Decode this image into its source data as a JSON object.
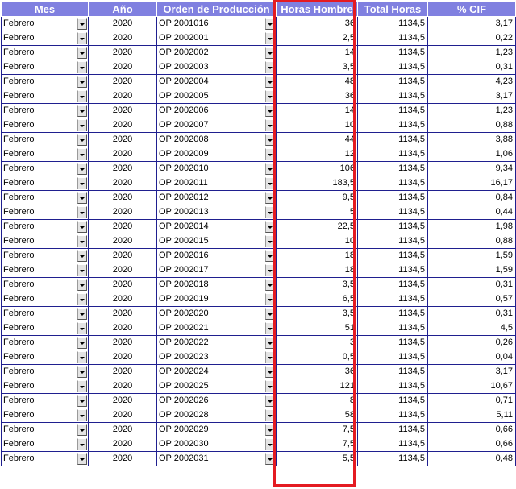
{
  "headers": {
    "mes": "Mes",
    "anio": "Año",
    "orden": "Orden de Producción",
    "horas_hombre": "Horas Hombre",
    "total_horas": "Total Horas",
    "cif": "% CIF"
  },
  "colors": {
    "header_bg": "#8080e0",
    "grid": "#1f1f8f",
    "highlight": "#e41b22"
  },
  "icons": {
    "dropdown": "chevron-down-icon"
  },
  "rows": [
    {
      "mes": "Febrero",
      "anio": "2020",
      "op": "OP 2001016",
      "hh": "36",
      "th": "1134,5",
      "cif": "3,17"
    },
    {
      "mes": "Febrero",
      "anio": "2020",
      "op": "OP 2002001",
      "hh": "2,5",
      "th": "1134,5",
      "cif": "0,22"
    },
    {
      "mes": "Febrero",
      "anio": "2020",
      "op": "OP 2002002",
      "hh": "14",
      "th": "1134,5",
      "cif": "1,23"
    },
    {
      "mes": "Febrero",
      "anio": "2020",
      "op": "OP 2002003",
      "hh": "3,5",
      "th": "1134,5",
      "cif": "0,31"
    },
    {
      "mes": "Febrero",
      "anio": "2020",
      "op": "OP 2002004",
      "hh": "48",
      "th": "1134,5",
      "cif": "4,23"
    },
    {
      "mes": "Febrero",
      "anio": "2020",
      "op": "OP 2002005",
      "hh": "36",
      "th": "1134,5",
      "cif": "3,17"
    },
    {
      "mes": "Febrero",
      "anio": "2020",
      "op": "OP 2002006",
      "hh": "14",
      "th": "1134,5",
      "cif": "1,23"
    },
    {
      "mes": "Febrero",
      "anio": "2020",
      "op": "OP 2002007",
      "hh": "10",
      "th": "1134,5",
      "cif": "0,88"
    },
    {
      "mes": "Febrero",
      "anio": "2020",
      "op": "OP 2002008",
      "hh": "44",
      "th": "1134,5",
      "cif": "3,88"
    },
    {
      "mes": "Febrero",
      "anio": "2020",
      "op": "OP 2002009",
      "hh": "12",
      "th": "1134,5",
      "cif": "1,06"
    },
    {
      "mes": "Febrero",
      "anio": "2020",
      "op": "OP 2002010",
      "hh": "106",
      "th": "1134,5",
      "cif": "9,34"
    },
    {
      "mes": "Febrero",
      "anio": "2020",
      "op": "OP 2002011",
      "hh": "183,5",
      "th": "1134,5",
      "cif": "16,17"
    },
    {
      "mes": "Febrero",
      "anio": "2020",
      "op": "OP 2002012",
      "hh": "9,5",
      "th": "1134,5",
      "cif": "0,84"
    },
    {
      "mes": "Febrero",
      "anio": "2020",
      "op": "OP 2002013",
      "hh": "5",
      "th": "1134,5",
      "cif": "0,44"
    },
    {
      "mes": "Febrero",
      "anio": "2020",
      "op": "OP 2002014",
      "hh": "22,5",
      "th": "1134,5",
      "cif": "1,98"
    },
    {
      "mes": "Febrero",
      "anio": "2020",
      "op": "OP 2002015",
      "hh": "10",
      "th": "1134,5",
      "cif": "0,88"
    },
    {
      "mes": "Febrero",
      "anio": "2020",
      "op": "OP 2002016",
      "hh": "18",
      "th": "1134,5",
      "cif": "1,59"
    },
    {
      "mes": "Febrero",
      "anio": "2020",
      "op": "OP 2002017",
      "hh": "18",
      "th": "1134,5",
      "cif": "1,59"
    },
    {
      "mes": "Febrero",
      "anio": "2020",
      "op": "OP 2002018",
      "hh": "3,5",
      "th": "1134,5",
      "cif": "0,31"
    },
    {
      "mes": "Febrero",
      "anio": "2020",
      "op": "OP 2002019",
      "hh": "6,5",
      "th": "1134,5",
      "cif": "0,57"
    },
    {
      "mes": "Febrero",
      "anio": "2020",
      "op": "OP 2002020",
      "hh": "3,5",
      "th": "1134,5",
      "cif": "0,31"
    },
    {
      "mes": "Febrero",
      "anio": "2020",
      "op": "OP 2002021",
      "hh": "51",
      "th": "1134,5",
      "cif": "4,5"
    },
    {
      "mes": "Febrero",
      "anio": "2020",
      "op": "OP 2002022",
      "hh": "3",
      "th": "1134,5",
      "cif": "0,26"
    },
    {
      "mes": "Febrero",
      "anio": "2020",
      "op": "OP 2002023",
      "hh": "0,5",
      "th": "1134,5",
      "cif": "0,04"
    },
    {
      "mes": "Febrero",
      "anio": "2020",
      "op": "OP 2002024",
      "hh": "36",
      "th": "1134,5",
      "cif": "3,17"
    },
    {
      "mes": "Febrero",
      "anio": "2020",
      "op": "OP 2002025",
      "hh": "121",
      "th": "1134,5",
      "cif": "10,67"
    },
    {
      "mes": "Febrero",
      "anio": "2020",
      "op": "OP 2002026",
      "hh": "8",
      "th": "1134,5",
      "cif": "0,71"
    },
    {
      "mes": "Febrero",
      "anio": "2020",
      "op": "OP 2002028",
      "hh": "58",
      "th": "1134,5",
      "cif": "5,11"
    },
    {
      "mes": "Febrero",
      "anio": "2020",
      "op": "OP 2002029",
      "hh": "7,5",
      "th": "1134,5",
      "cif": "0,66"
    },
    {
      "mes": "Febrero",
      "anio": "2020",
      "op": "OP 2002030",
      "hh": "7,5",
      "th": "1134,5",
      "cif": "0,66"
    },
    {
      "mes": "Febrero",
      "anio": "2020",
      "op": "OP 2002031",
      "hh": "5,5",
      "th": "1134,5",
      "cif": "0,48"
    }
  ]
}
